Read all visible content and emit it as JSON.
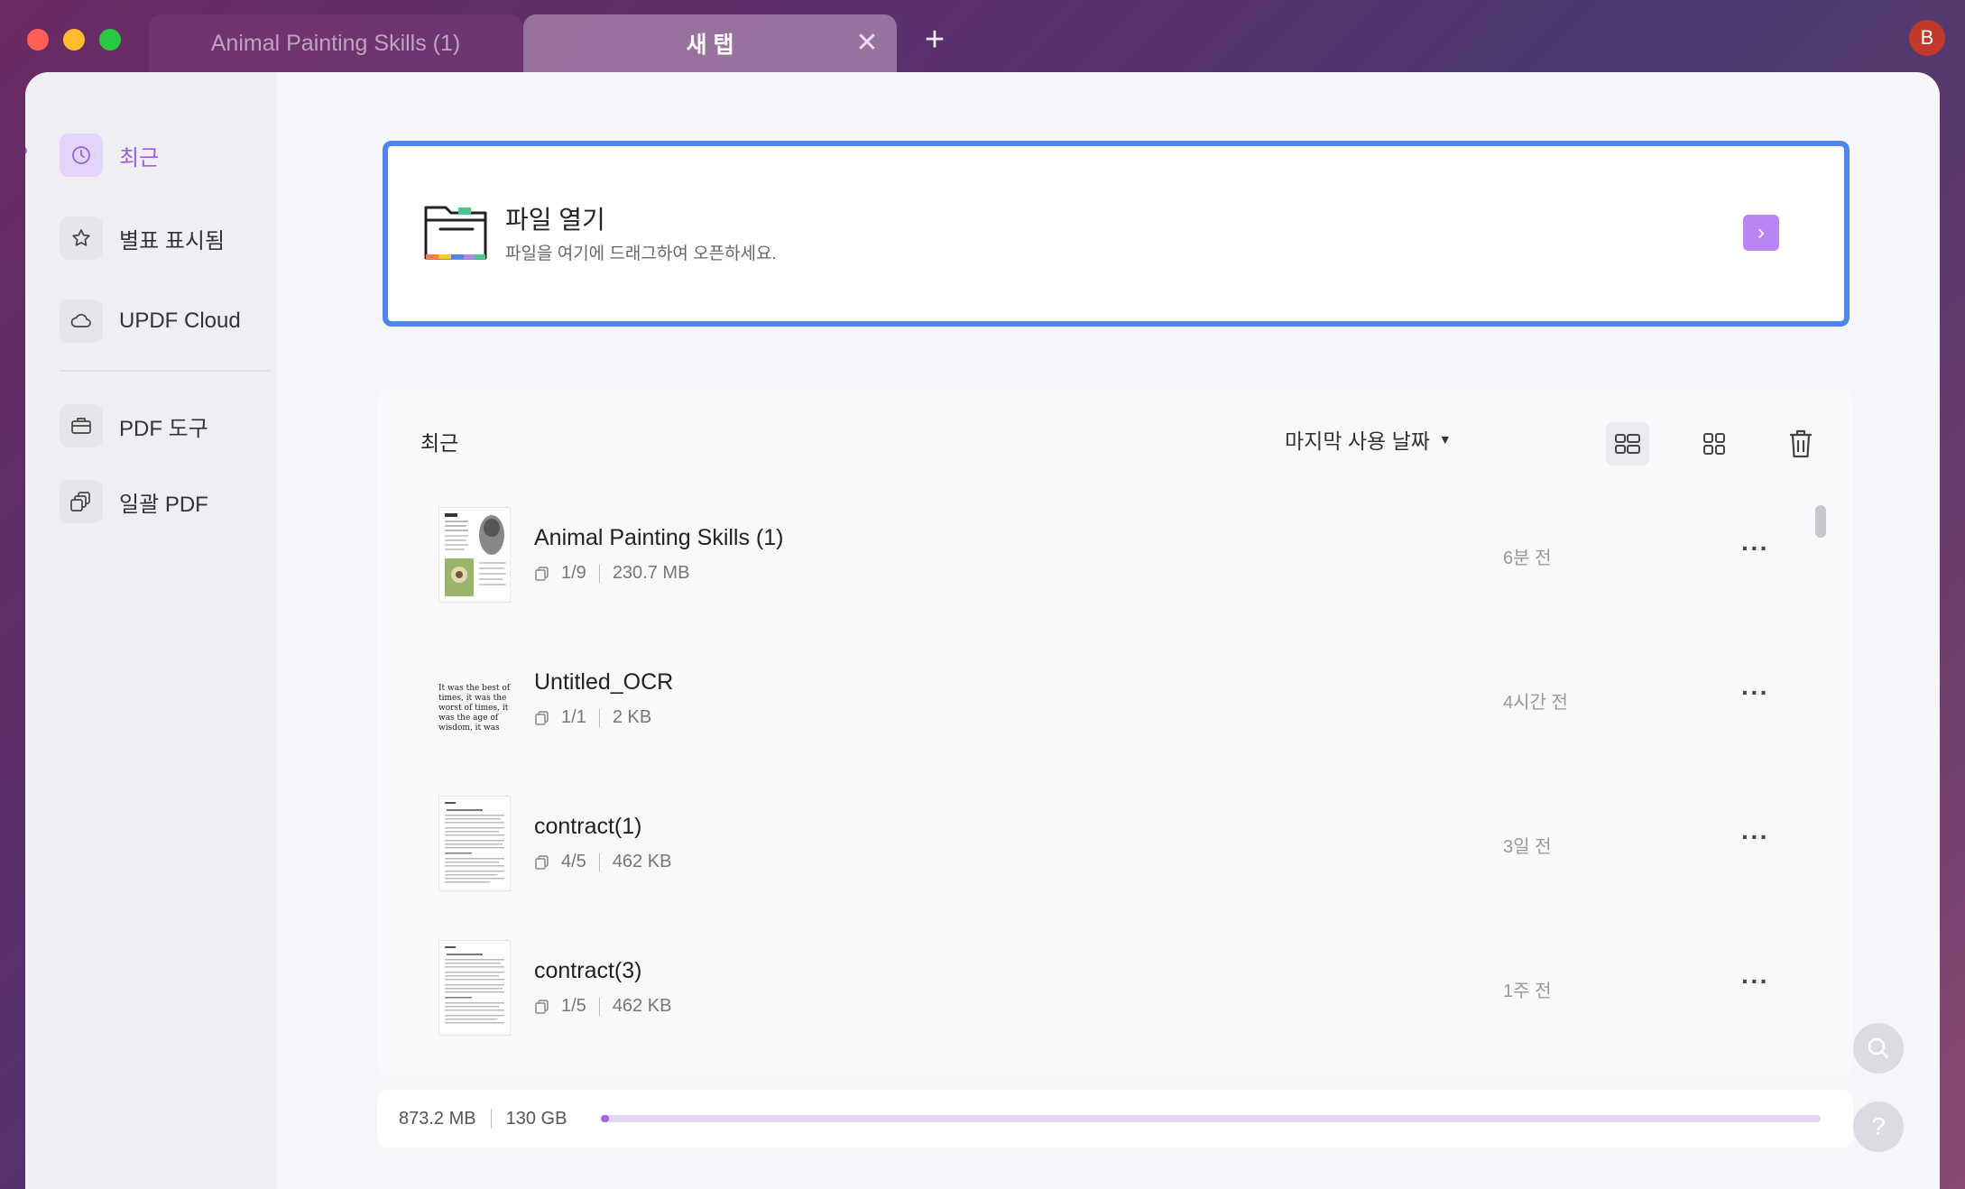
{
  "tabs": [
    {
      "label": "Animal Painting Skills (1)",
      "active": false
    },
    {
      "label": "새 탭",
      "active": true
    }
  ],
  "tab_close": "✕",
  "add_tab": "+",
  "user": {
    "avatar_letter": "B",
    "avatar_color": "#c0392b"
  },
  "sidebar": {
    "items": [
      {
        "label": "최근",
        "icon": "clock-icon",
        "active": true
      },
      {
        "label": "별표 표시됨",
        "icon": "star-icon",
        "active": false
      },
      {
        "label": "UPDF Cloud",
        "icon": "cloud-icon",
        "active": false
      },
      {
        "label": "PDF 도구",
        "icon": "toolbox-icon",
        "active": false
      },
      {
        "label": "일괄 PDF",
        "icon": "batch-icon",
        "active": false
      }
    ]
  },
  "open_file": {
    "title": "파일 열기",
    "subtitle": "파일을 여기에 드래그하여 오픈하세요.",
    "go_icon": "›"
  },
  "recent": {
    "title": "최근",
    "sort_label": "마지막 사용 날짜",
    "sort_caret": "▼",
    "files": [
      {
        "name": "Animal Painting Skills (1)",
        "pages": "1/9",
        "size": "230.7 MB",
        "time": "6분 전",
        "more": "···"
      },
      {
        "name": "Untitled_OCR",
        "pages": "1/1",
        "size": "2 KB",
        "time": "4시간 전",
        "more": "···"
      },
      {
        "name": "contract(1)",
        "pages": "4/5",
        "size": "462 KB",
        "time": "3일 전",
        "more": "···"
      },
      {
        "name": "contract(3)",
        "pages": "1/5",
        "size": "462 KB",
        "time": "1주 전",
        "more": "···"
      }
    ],
    "ocr_thumb_text": "It was the best of times, it was the worst of times, it was the age of wisdom, it was the age of foolishness..."
  },
  "storage": {
    "used": "873.2 MB",
    "total": "130 GB",
    "used_fraction": 0.0066
  },
  "colors": {
    "accent": "#9b5ee6",
    "open_border": "#4e86ee",
    "go_button": "#b985f3"
  },
  "help_label": "?"
}
